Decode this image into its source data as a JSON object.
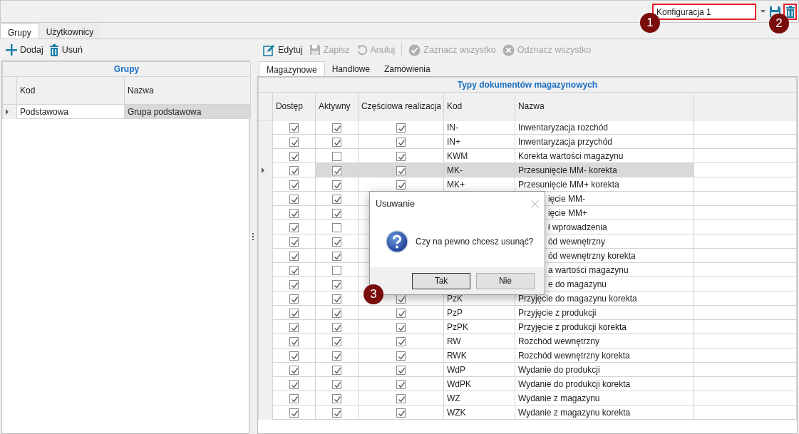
{
  "top_bar": {
    "configuration": {
      "value": "Konfiguracja 1"
    }
  },
  "callouts": [
    {
      "label": "1"
    },
    {
      "label": "2"
    },
    {
      "label": "3"
    }
  ],
  "tabs": [
    {
      "label": "Grupy",
      "selected": true
    },
    {
      "label": "Użytkownicy",
      "selected": false
    }
  ],
  "left_panel": {
    "actions": [
      {
        "label": "Dodaj",
        "kind": "add"
      },
      {
        "label": "Usuń",
        "kind": "delete"
      }
    ],
    "grid": {
      "title": "Grupy",
      "columns": [
        "Kod",
        "Nazwa"
      ],
      "rows": [
        {
          "kod": "Podstawowa",
          "nazwa": "Grupa podstawowa",
          "selected": true
        }
      ]
    }
  },
  "right_panel": {
    "actions": [
      {
        "label": "Edytuj",
        "kind": "edit",
        "disabled": false
      },
      {
        "label": "Zapisz",
        "kind": "save",
        "disabled": true
      },
      {
        "label": "Anuluj",
        "kind": "undo",
        "disabled": true
      },
      {
        "label": "Zaznacz wszystko",
        "kind": "check-all",
        "disabled": true
      },
      {
        "label": "Odznacz wszystko",
        "kind": "uncheck-all",
        "disabled": true
      }
    ],
    "tabs": [
      {
        "label": "Magazynowe",
        "selected": true
      },
      {
        "label": "Handlowe",
        "selected": false
      },
      {
        "label": "Zamówienia",
        "selected": false
      }
    ],
    "grid": {
      "title": "Typy dokumentów magazynowych",
      "columns": [
        "Dostęp",
        "Aktywny",
        "Częściowa realizacja",
        "Kod",
        "Nazwa"
      ],
      "rows": [
        {
          "dostep": true,
          "aktywny": true,
          "czesciowa": true,
          "kod": "IN-",
          "nazwa": "Inwentaryzacja rozchód",
          "selected": false
        },
        {
          "dostep": true,
          "aktywny": true,
          "czesciowa": true,
          "kod": "IN+",
          "nazwa": "Inwentaryzacja przychód",
          "selected": false
        },
        {
          "dostep": true,
          "aktywny": false,
          "czesciowa": true,
          "kod": "KWM",
          "nazwa": "Korekta wartości magazynu",
          "selected": false
        },
        {
          "dostep": true,
          "aktywny": true,
          "czesciowa": true,
          "kod": "MK-",
          "nazwa": "Przesunięcie MM- korekta",
          "selected": true
        },
        {
          "dostep": true,
          "aktywny": true,
          "czesciowa": true,
          "kod": "MK+",
          "nazwa": "Przesunięcie MM+ korekta",
          "selected": false
        },
        {
          "dostep": true,
          "aktywny": true,
          "nazwa": "ięcie MM-",
          "selected": false
        },
        {
          "dostep": true,
          "aktywny": true,
          "nazwa": "ięcie MM+",
          "selected": false
        },
        {
          "dostep": true,
          "aktywny": false,
          "nazwa": "ł wprowadzenia",
          "selected": false
        },
        {
          "dostep": true,
          "aktywny": true,
          "nazwa": "ód wewnętrzny",
          "selected": false
        },
        {
          "dostep": true,
          "aktywny": true,
          "nazwa": "ód wewnętrzny korekta",
          "selected": false
        },
        {
          "dostep": true,
          "aktywny": false,
          "nazwa": "a wartości magazynu",
          "selected": false
        },
        {
          "dostep": true,
          "aktywny": true,
          "nazwa": "e do magazynu",
          "selected": false
        },
        {
          "dostep": true,
          "aktywny": true,
          "czesciowa": true,
          "kod": "PzK",
          "nazwa": "Przyjęcie do magazynu korekta",
          "selected": false
        },
        {
          "dostep": true,
          "aktywny": true,
          "czesciowa": true,
          "kod": "PzP",
          "nazwa": "Przyjęcie z produkcji",
          "selected": false
        },
        {
          "dostep": true,
          "aktywny": true,
          "czesciowa": true,
          "kod": "PzPK",
          "nazwa": "Przyjęcie z produkcji korekta",
          "selected": false
        },
        {
          "dostep": true,
          "aktywny": true,
          "czesciowa": true,
          "kod": "RW",
          "nazwa": "Rozchód wewnętrzny",
          "selected": false
        },
        {
          "dostep": true,
          "aktywny": true,
          "czesciowa": true,
          "kod": "RWK",
          "nazwa": "Rozchód wewnętrzny korekta",
          "selected": false
        },
        {
          "dostep": true,
          "aktywny": true,
          "czesciowa": true,
          "kod": "WdP",
          "nazwa": "Wydanie do produkcji",
          "selected": false
        },
        {
          "dostep": true,
          "aktywny": true,
          "czesciowa": true,
          "kod": "WdPK",
          "nazwa": "Wydanie do produkcji korekta",
          "selected": false
        },
        {
          "dostep": true,
          "aktywny": true,
          "czesciowa": true,
          "kod": "WZ",
          "nazwa": "Wydanie z magazynu",
          "selected": false
        },
        {
          "dostep": true,
          "aktywny": true,
          "czesciowa": true,
          "kod": "WZK",
          "nazwa": "Wydanie z magazynu korekta",
          "selected": false
        }
      ]
    }
  },
  "dialog": {
    "title": "Usuwanie",
    "message": "Czy na pewno chcesz usunąć?",
    "buttons": [
      "Tak",
      "Nie"
    ]
  }
}
